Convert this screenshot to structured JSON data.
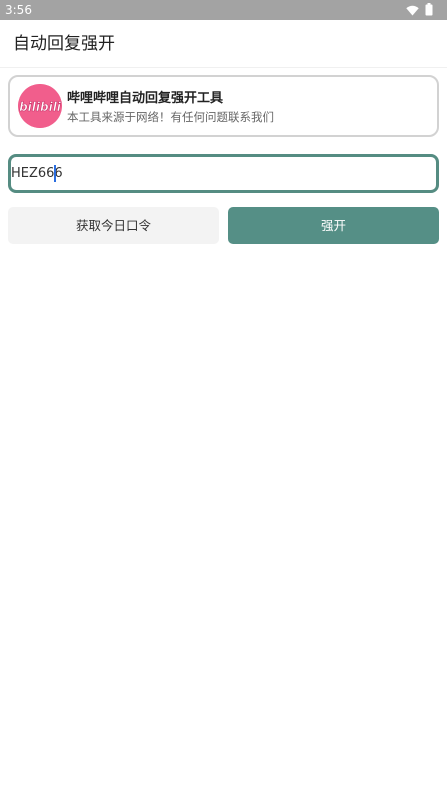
{
  "status_bar": {
    "time": "3:56",
    "icons": [
      "wifi-icon",
      "battery-icon"
    ]
  },
  "app_bar": {
    "title": "自动回复强开"
  },
  "info_card": {
    "logo_text": "bilibili",
    "title": "哔哩哔哩自动回复强开工具",
    "subtitle": "本工具来源于网络！有任何问题联系我们"
  },
  "code_input": {
    "value": "HEZ666"
  },
  "buttons": {
    "get_code": "获取今日口令",
    "force_open": "强开"
  },
  "colors": {
    "status_bar": "#a3a3a3",
    "accent": "#558f86",
    "logo_pink": "#f15e8c",
    "secondary_button": "#f3f3f3"
  }
}
